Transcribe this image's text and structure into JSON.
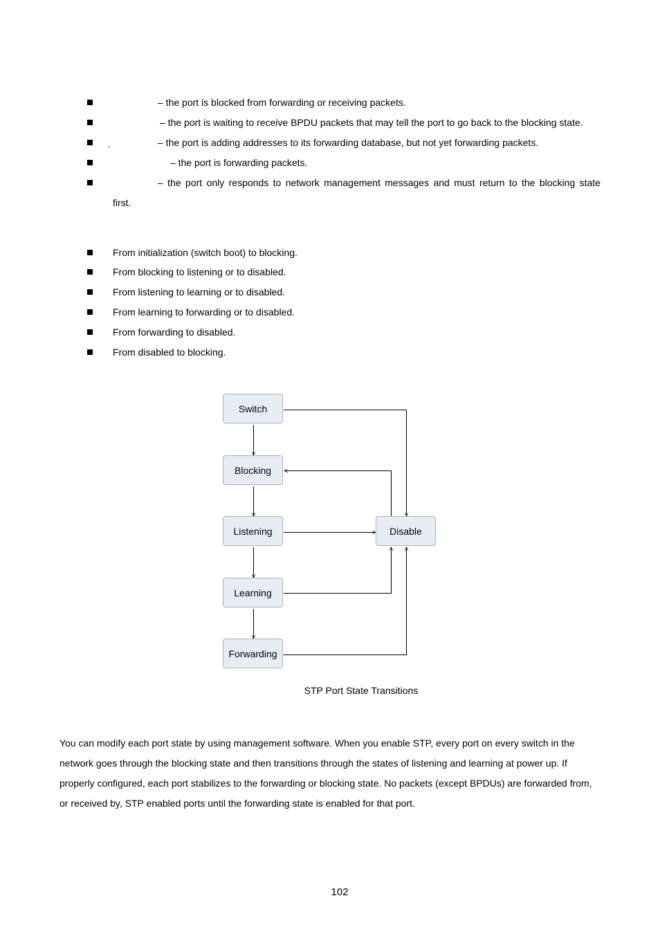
{
  "state_list": [
    {
      "text": "– the port is blocked from forwarding or receiving packets."
    },
    {
      "text": "– the port is waiting to receive BPDU packets that may tell the port to go back to the blocking state."
    },
    {
      "text": "– the port is adding addresses to its forwarding database, but not yet forwarding packets.",
      "marker": "."
    },
    {
      "text": "– the port is forwarding packets."
    },
    {
      "text": "– the port only responds to network management messages and must return to the blocking state",
      "continuation": "first."
    }
  ],
  "transition_list": [
    "From initialization (switch boot) to blocking.",
    "From blocking to listening or to disabled.",
    "From listening to learning or to disabled.",
    "From learning to forwarding or to disabled.",
    "From forwarding to disabled.",
    "From disabled to blocking."
  ],
  "diagram": {
    "nodes": {
      "switch": "Switch",
      "blocking": "Blocking",
      "listening": "Listening",
      "learning": "Learning",
      "forwarding": "Forwarding",
      "disable": "Disable"
    },
    "edges": [
      {
        "from": "switch",
        "to": "blocking"
      },
      {
        "from": "blocking",
        "to": "listening"
      },
      {
        "from": "listening",
        "to": "learning"
      },
      {
        "from": "learning",
        "to": "forwarding"
      },
      {
        "from": "switch",
        "to": "disable"
      },
      {
        "from": "disable",
        "to": "blocking"
      },
      {
        "from": "listening",
        "to": "disable"
      },
      {
        "from": "learning",
        "to": "disable"
      },
      {
        "from": "forwarding",
        "to": "disable"
      }
    ],
    "caption": "STP Port State Transitions"
  },
  "paragraph": [
    "You can modify each port state by using management software. When you enable STP, every port on every switch in the",
    "network goes through the blocking state and then transitions through the states of listening and learning at power up. If",
    "properly configured, each port stabilizes to the forwarding or blocking state. No packets (except BPDUs) are forwarded from,",
    "or received by, STP enabled ports until the forwarding state is enabled for that port."
  ],
  "page_number": "102"
}
